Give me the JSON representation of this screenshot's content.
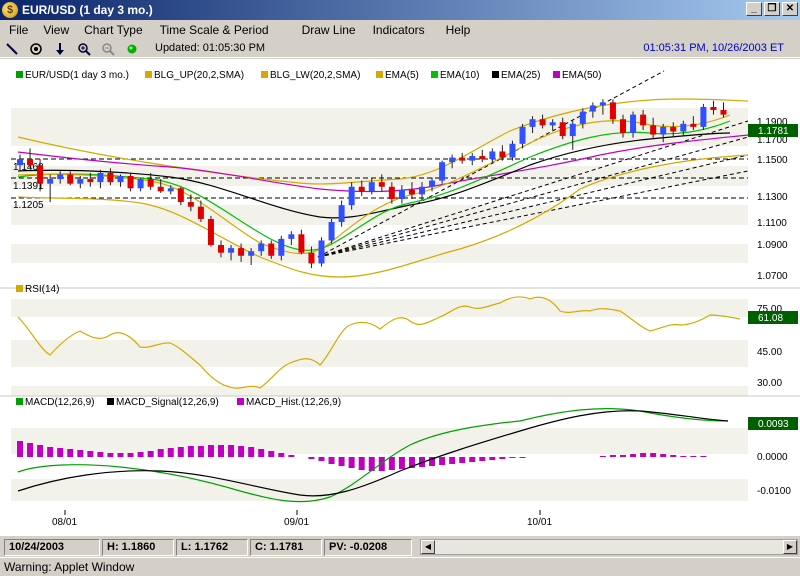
{
  "window": {
    "title": "EUR/USD (1 day  3 mo.)",
    "buttons": [
      "_",
      "❐",
      "✕"
    ]
  },
  "menu": [
    "File",
    "View",
    "Chart Type",
    "Time Scale & Period",
    "Draw Line",
    "Indicators",
    "Help"
  ],
  "toolbar": {
    "updated": "Updated: 01:05:30 PM",
    "clock": "01:05:31 PM, 10/26/2003 ET"
  },
  "price_legend": [
    {
      "label": "EUR/USD(1 day  3 mo.)",
      "color": "#00a000"
    },
    {
      "label": "BLG_UP(20,2,SMA)",
      "color": "#d4aa00"
    },
    {
      "label": "BLG_LW(20,2,SMA)",
      "color": "#d4aa00"
    },
    {
      "label": "EMA(5)",
      "color": "#d4aa00"
    },
    {
      "label": "EMA(10)",
      "color": "#00c000"
    },
    {
      "label": "EMA(25)",
      "color": "#000000"
    },
    {
      "label": "EMA(50)",
      "color": "#c000c0"
    }
  ],
  "rsi_legend": [
    {
      "label": "RSI(14)",
      "color": "#d4aa00"
    }
  ],
  "macd_legend": [
    {
      "label": "MACD(12,26,9)",
      "color": "#00a000"
    },
    {
      "label": "MACD_Signal(12,26,9)",
      "color": "#000000"
    },
    {
      "label": "MACD_Hist.(12,26,9)",
      "color": "#c000c0"
    }
  ],
  "price_axis": [
    "1.1900",
    "1.1700",
    "1.1500",
    "1.1300",
    "1.1100",
    "1.0900",
    "1.0700"
  ],
  "price_last": "1.1781",
  "rsi_axis": [
    "75.00",
    "45.00",
    "30.00"
  ],
  "rsi_last": "61.08",
  "macd_axis": [
    "0.0000",
    "-0.0100"
  ],
  "macd_last": "0.0093",
  "hlines": [
    "1.1468",
    "1.1391",
    "1.1205"
  ],
  "x_labels": [
    "08/01",
    "09/01",
    "10/01"
  ],
  "status": {
    "date": "10/24/2003",
    "high": "H: 1.1860",
    "low": "L: 1.1762",
    "close": "C: 1.1781",
    "pv": "PV: -0.0208"
  },
  "warning": "Warning: Applet Window",
  "chart_data": {
    "type": "candlestick",
    "ylim": [
      1.065,
      1.196
    ],
    "candles": [
      [
        1.145,
        1.152,
        1.141,
        1.149
      ],
      [
        1.149,
        1.156,
        1.143,
        1.145
      ],
      [
        1.145,
        1.149,
        1.128,
        1.133
      ],
      [
        1.133,
        1.139,
        1.121,
        1.136
      ],
      [
        1.136,
        1.142,
        1.133,
        1.139
      ],
      [
        1.139,
        1.141,
        1.132,
        1.133
      ],
      [
        1.133,
        1.138,
        1.13,
        1.136
      ],
      [
        1.136,
        1.14,
        1.131,
        1.134
      ],
      [
        1.134,
        1.142,
        1.13,
        1.14
      ],
      [
        1.14,
        1.143,
        1.132,
        1.134
      ],
      [
        1.134,
        1.139,
        1.131,
        1.138
      ],
      [
        1.138,
        1.14,
        1.128,
        1.13
      ],
      [
        1.13,
        1.137,
        1.128,
        1.136
      ],
      [
        1.136,
        1.14,
        1.129,
        1.131
      ],
      [
        1.131,
        1.136,
        1.127,
        1.128
      ],
      [
        1.128,
        1.132,
        1.126,
        1.13
      ],
      [
        1.13,
        1.131,
        1.119,
        1.121
      ],
      [
        1.121,
        1.126,
        1.115,
        1.118
      ],
      [
        1.118,
        1.122,
        1.108,
        1.11
      ],
      [
        1.11,
        1.112,
        1.092,
        1.093
      ],
      [
        1.093,
        1.096,
        1.085,
        1.088
      ],
      [
        1.088,
        1.093,
        1.083,
        1.091
      ],
      [
        1.091,
        1.094,
        1.082,
        1.086
      ],
      [
        1.086,
        1.091,
        1.08,
        1.089
      ],
      [
        1.089,
        1.096,
        1.086,
        1.094
      ],
      [
        1.094,
        1.096,
        1.084,
        1.086
      ],
      [
        1.086,
        1.099,
        1.083,
        1.097
      ],
      [
        1.097,
        1.102,
        1.093,
        1.1
      ],
      [
        1.1,
        1.103,
        1.087,
        1.088
      ],
      [
        1.088,
        1.092,
        1.078,
        1.081
      ],
      [
        1.081,
        1.098,
        1.079,
        1.096
      ],
      [
        1.096,
        1.11,
        1.094,
        1.108
      ],
      [
        1.108,
        1.122,
        1.105,
        1.119
      ],
      [
        1.119,
        1.134,
        1.116,
        1.131
      ],
      [
        1.131,
        1.135,
        1.125,
        1.128
      ],
      [
        1.128,
        1.137,
        1.126,
        1.134
      ],
      [
        1.134,
        1.139,
        1.128,
        1.131
      ],
      [
        1.131,
        1.134,
        1.12,
        1.123
      ],
      [
        1.123,
        1.132,
        1.12,
        1.129
      ],
      [
        1.129,
        1.134,
        1.123,
        1.126
      ],
      [
        1.126,
        1.134,
        1.122,
        1.131
      ],
      [
        1.131,
        1.137,
        1.128,
        1.135
      ],
      [
        1.135,
        1.148,
        1.133,
        1.147
      ],
      [
        1.147,
        1.152,
        1.143,
        1.15
      ],
      [
        1.15,
        1.153,
        1.146,
        1.148
      ],
      [
        1.148,
        1.153,
        1.145,
        1.151
      ],
      [
        1.151,
        1.155,
        1.147,
        1.149
      ],
      [
        1.149,
        1.156,
        1.146,
        1.154
      ],
      [
        1.154,
        1.158,
        1.148,
        1.15
      ],
      [
        1.15,
        1.161,
        1.148,
        1.159
      ],
      [
        1.159,
        1.172,
        1.156,
        1.17
      ],
      [
        1.17,
        1.177,
        1.166,
        1.175
      ],
      [
        1.175,
        1.178,
        1.169,
        1.171
      ],
      [
        1.171,
        1.175,
        1.168,
        1.173
      ],
      [
        1.173,
        1.176,
        1.162,
        1.164
      ],
      [
        1.164,
        1.174,
        1.155,
        1.172
      ],
      [
        1.172,
        1.182,
        1.169,
        1.18
      ],
      [
        1.18,
        1.186,
        1.176,
        1.184
      ],
      [
        1.184,
        1.188,
        1.178,
        1.186
      ],
      [
        1.186,
        1.188,
        1.172,
        1.175
      ],
      [
        1.175,
        1.178,
        1.163,
        1.166
      ],
      [
        1.166,
        1.18,
        1.163,
        1.178
      ],
      [
        1.178,
        1.181,
        1.168,
        1.171
      ],
      [
        1.171,
        1.176,
        1.162,
        1.165
      ],
      [
        1.165,
        1.172,
        1.16,
        1.17
      ],
      [
        1.17,
        1.173,
        1.164,
        1.167
      ],
      [
        1.167,
        1.174,
        1.164,
        1.172
      ],
      [
        1.172,
        1.177,
        1.168,
        1.17
      ],
      [
        1.17,
        1.185,
        1.168,
        1.183
      ],
      [
        1.183,
        1.187,
        1.178,
        1.181
      ],
      [
        1.181,
        1.186,
        1.176,
        1.178
      ]
    ]
  }
}
